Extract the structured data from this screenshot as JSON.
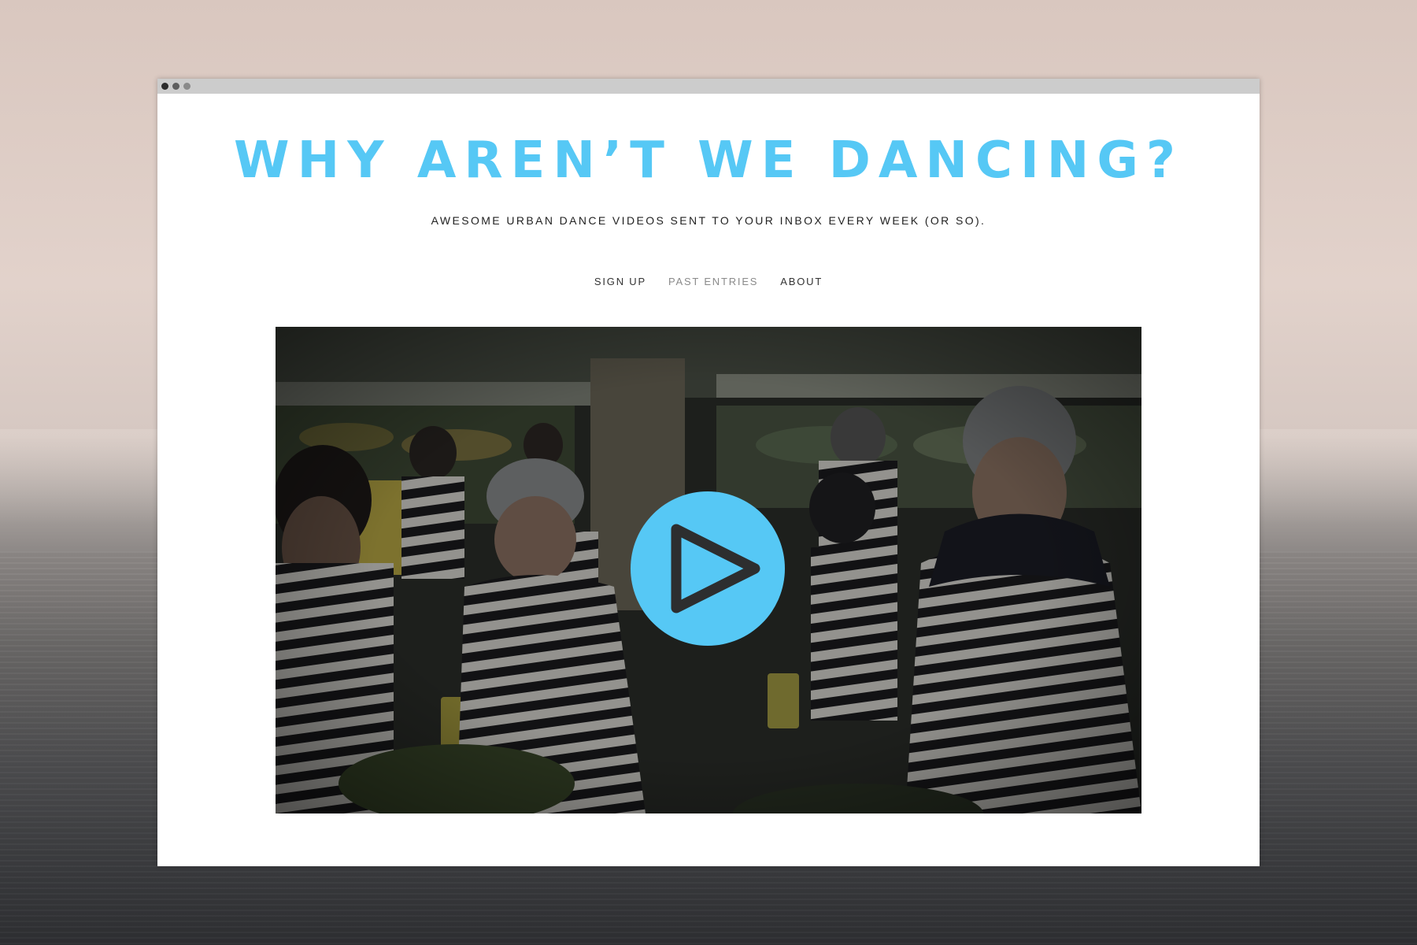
{
  "site": {
    "title": "WHY AREN’T WE DANCING?",
    "tagline": "AWESOME URBAN DANCE VIDEOS SENT TO YOUR INBOX EVERY WEEK (OR SO)."
  },
  "nav": {
    "items": [
      {
        "label": "SIGN UP"
      },
      {
        "label": "PAST ENTRIES"
      },
      {
        "label": "ABOUT"
      }
    ]
  },
  "video": {
    "play_icon": "play-icon"
  },
  "colors": {
    "accent": "#56c8f5",
    "nav_text": "#333333",
    "nav_muted": "#8a8a8a",
    "titlebar": "#cccccc"
  }
}
